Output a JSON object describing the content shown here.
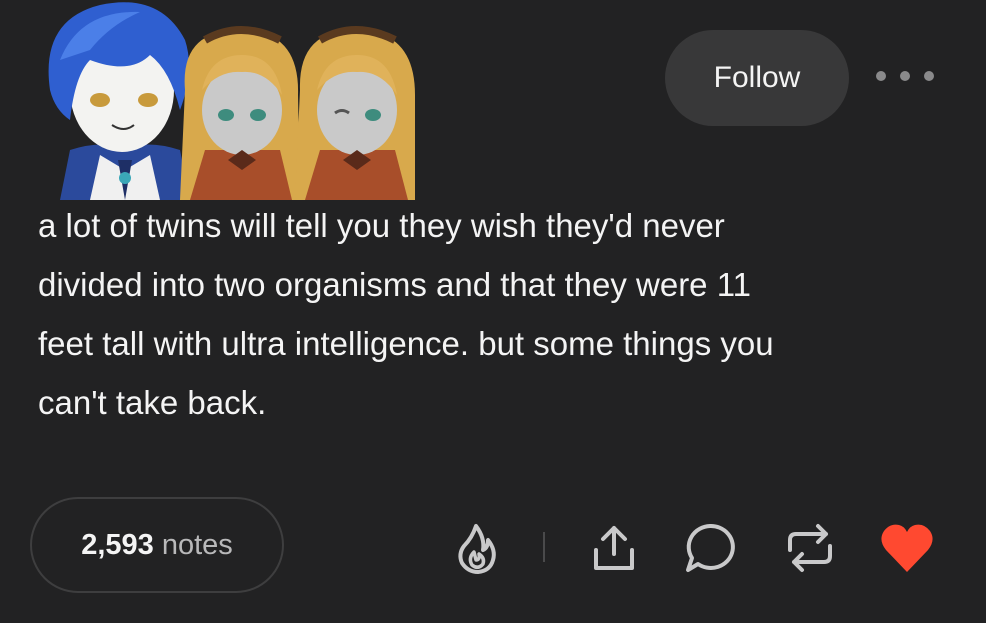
{
  "header": {
    "follow_label": "Follow",
    "more_icon": "ellipsis-icon"
  },
  "post": {
    "lines": [
      "a lot of twins will tell you they wish they'd never",
      "divided into two organisms and that they were 11",
      "feet tall with ultra intelligence. but some things you",
      "can't take back."
    ]
  },
  "footer": {
    "notes_count": "2,593",
    "notes_label": "notes",
    "actions": [
      "blaze-icon",
      "share-icon",
      "reply-icon",
      "reblog-icon",
      "like-icon"
    ],
    "like_color": "#ff4930"
  },
  "colors": {
    "background": "#222223",
    "button_bg": "#383839",
    "accent_heart": "#ff4930"
  }
}
